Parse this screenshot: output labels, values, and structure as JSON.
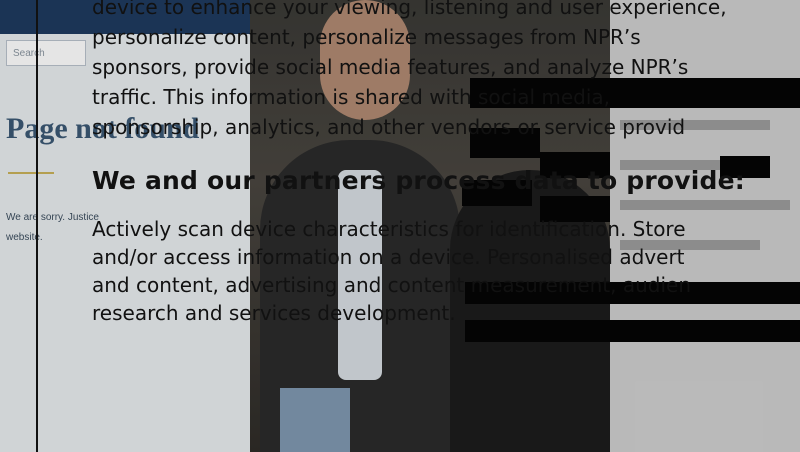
{
  "background": {
    "search_placeholder": "Search",
    "page_not_found": "Page not found",
    "sorry_text": "We are sorry. Justice website."
  },
  "consent": {
    "paragraph_lines": [
      "device to enhance your viewing, listening and user experience,",
      "personalize content, personalize messages from NPR’s",
      "sponsors, provide social media features, and analyze NPR’s",
      "traffic. This information is shared with social media,",
      "sponsorship, analytics, and other vendors or service provid"
    ],
    "heading": "We and our partners process data to provide:",
    "purposes_lines": [
      "Actively scan device characteristics for identification. Store",
      "and/or access information on a device. Personalised advert",
      "and content, advertising and content measurement, audien",
      "research and services development."
    ]
  },
  "colors": {
    "text": "#111111",
    "overlay": "#000000"
  }
}
